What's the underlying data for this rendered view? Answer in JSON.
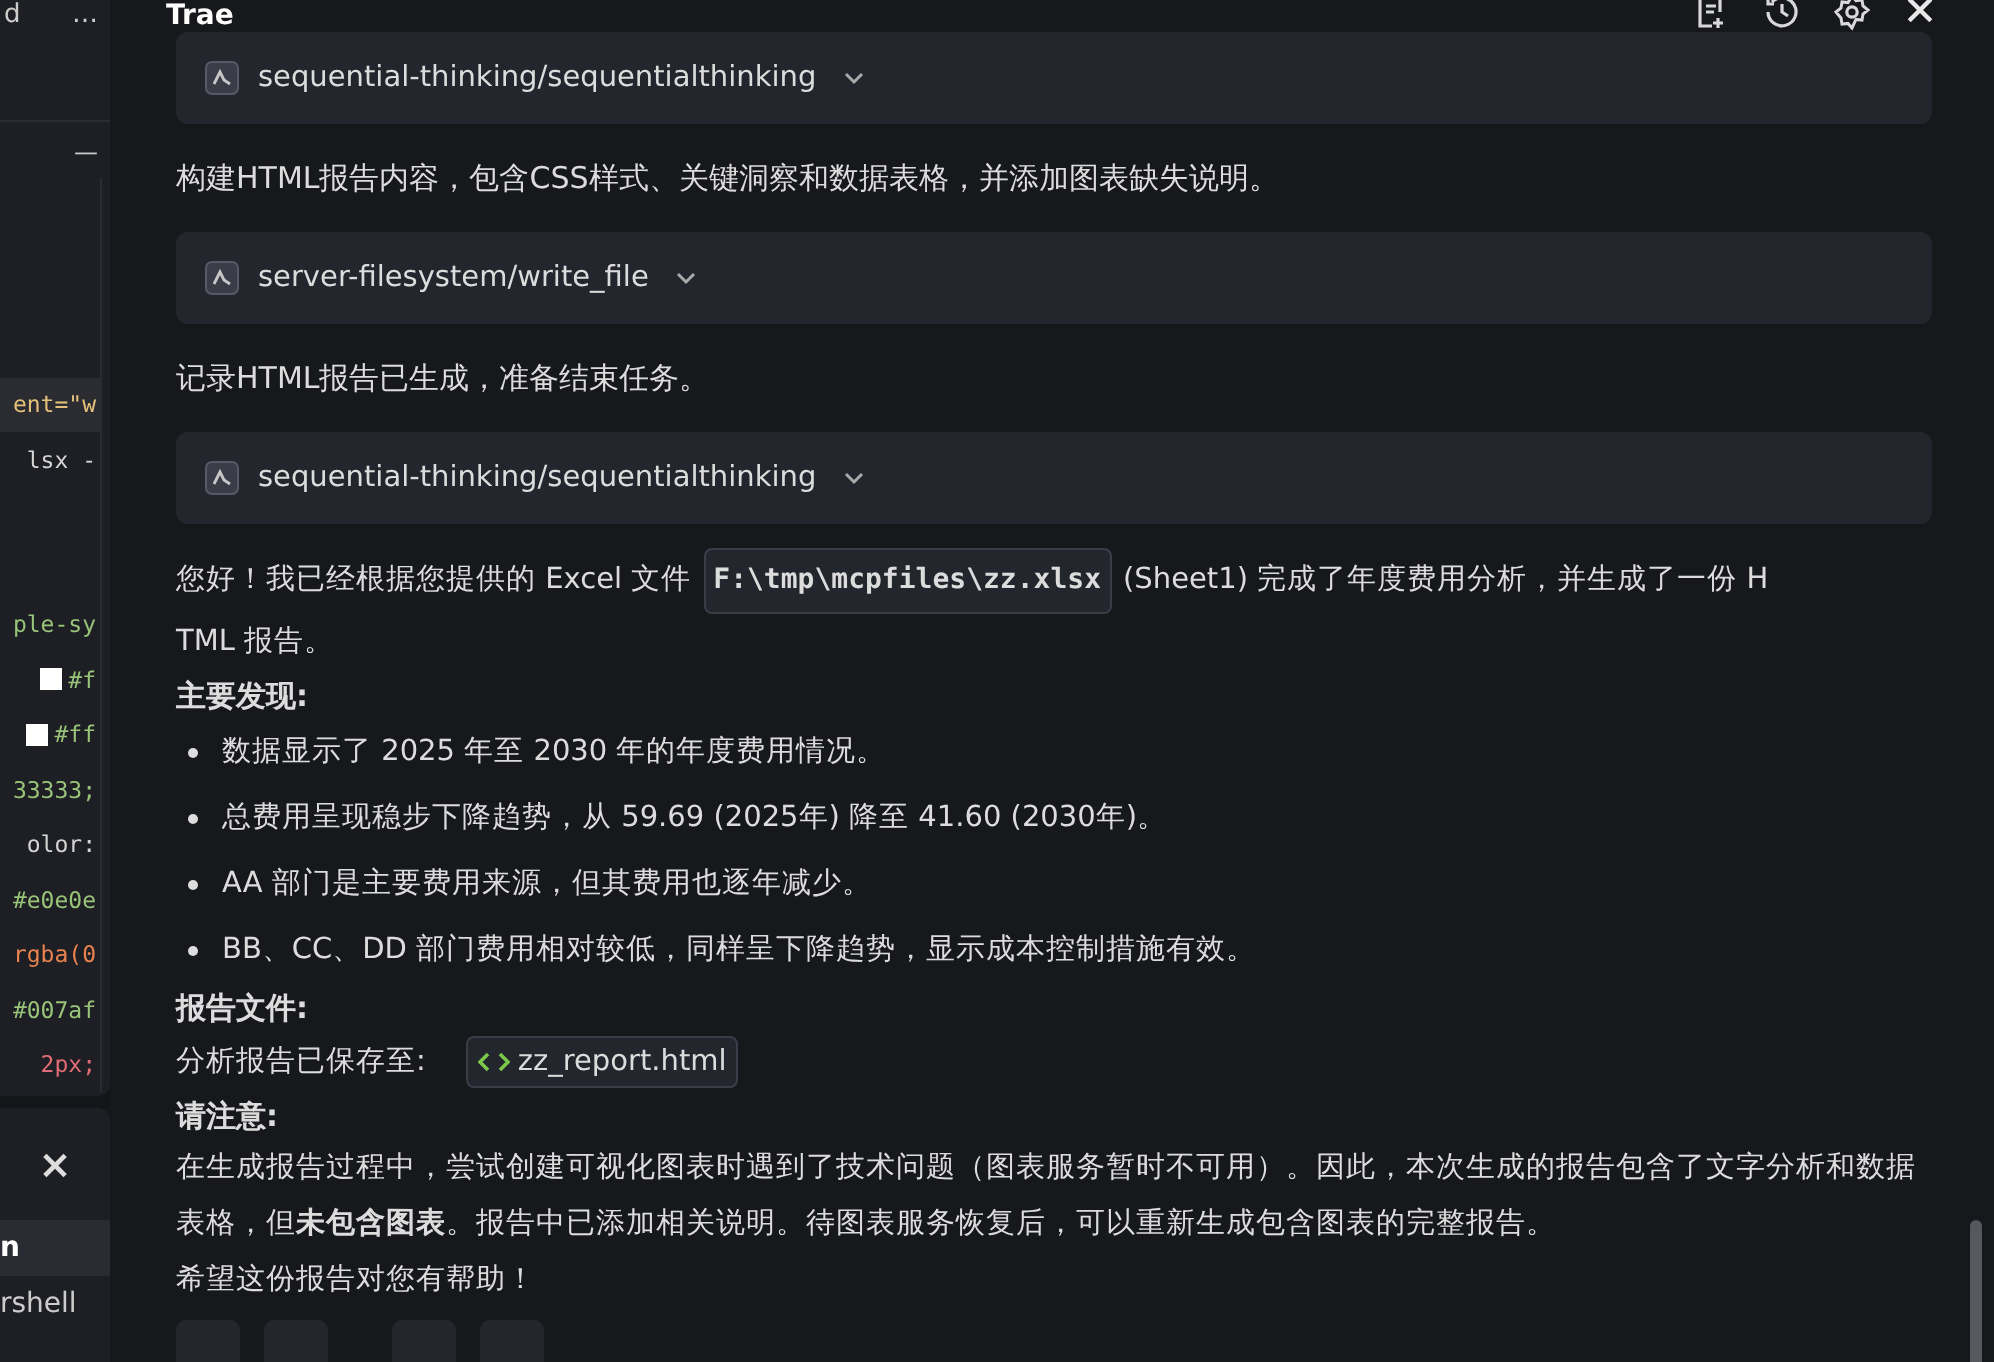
{
  "editor": {
    "tab_label": "d",
    "more": "…",
    "minimize": "—",
    "lines": [
      {
        "highlight": false
      },
      {
        "text": "ent=\"w",
        "kind": "attr",
        "highlight": true
      },
      {
        "text": "lsx -",
        "kind": "plain",
        "highlight": false
      },
      {
        "highlight": false
      },
      {
        "highlight": false
      },
      {
        "text": "ple-sy",
        "kind": "value",
        "highlight": false
      },
      {
        "text": "#f",
        "kind": "value",
        "swatch": true,
        "highlight": false
      },
      {
        "text": "#ff",
        "kind": "value",
        "swatch": true,
        "highlight": false
      },
      {
        "text": "33333;",
        "kind": "value",
        "highlight": false
      },
      {
        "text": "olor:",
        "kind": "plain",
        "highlight": false
      },
      {
        "text": "#e0e0e",
        "kind": "value",
        "highlight": false
      },
      {
        "text": "rgba(0",
        "kind": "func",
        "highlight": false
      },
      {
        "text": "#007af",
        "kind": "value",
        "highlight": false
      },
      {
        "text": "2px;",
        "kind": "unit",
        "highlight": false
      }
    ]
  },
  "terminal": {
    "close": "×",
    "items": [
      {
        "label": "n",
        "selected": true
      },
      {
        "label": "rshell",
        "selected": false
      }
    ]
  },
  "chat": {
    "title": "Trae",
    "blocks": [
      {
        "kind": "tool",
        "label": "sequential-thinking/sequentialthinking"
      },
      {
        "kind": "text",
        "text": "构建HTML报告内容，包含CSS样式、关键洞察和数据表格，并添加图表缺失说明。"
      },
      {
        "kind": "tool",
        "label": "server-filesystem/write_file"
      },
      {
        "kind": "text",
        "text": "记录HTML报告已生成，准备结束任务。"
      },
      {
        "kind": "tool",
        "label": "sequential-thinking/sequentialthinking"
      }
    ],
    "answer": {
      "intro_before": "您好！我已经根据您提供的 Excel 文件",
      "path": "F:\\tmp\\mcpfiles\\zz.xlsx",
      "intro_after": "(Sheet1) 完成了年度费用分析，并生成了一份 H",
      "intro_cont": "TML 报告。",
      "findings_heading": "主要发现:",
      "findings": [
        "数据显示了 2025 年至 2030 年的年度费用情况。",
        "总费用呈现稳步下降趋势，从 59.69 (2025年) 降至 41.60 (2030年)。",
        "AA 部门是主要费用来源，但其费用也逐年减少。",
        "BB、CC、DD 部门费用相对较低，同样呈下降趋势，显示成本控制措施有效。"
      ],
      "file_heading": "报告文件:",
      "file_label": "分析报告已保存至:",
      "file_name": "zz_report.html",
      "note_heading": "请注意:",
      "note": "在生成报告过程中，尝试创建可视化图表时遇到了技术问题（图表服务暂时不可用）。因此，本次生成的报告包含了文字分析和数据表格，但**未包含图表**。报告中已添加相关说明。待图表服务恢复后，可以重新生成包含图表的完整报告。",
      "closing": "希望这份报告对您有帮助！"
    }
  }
}
